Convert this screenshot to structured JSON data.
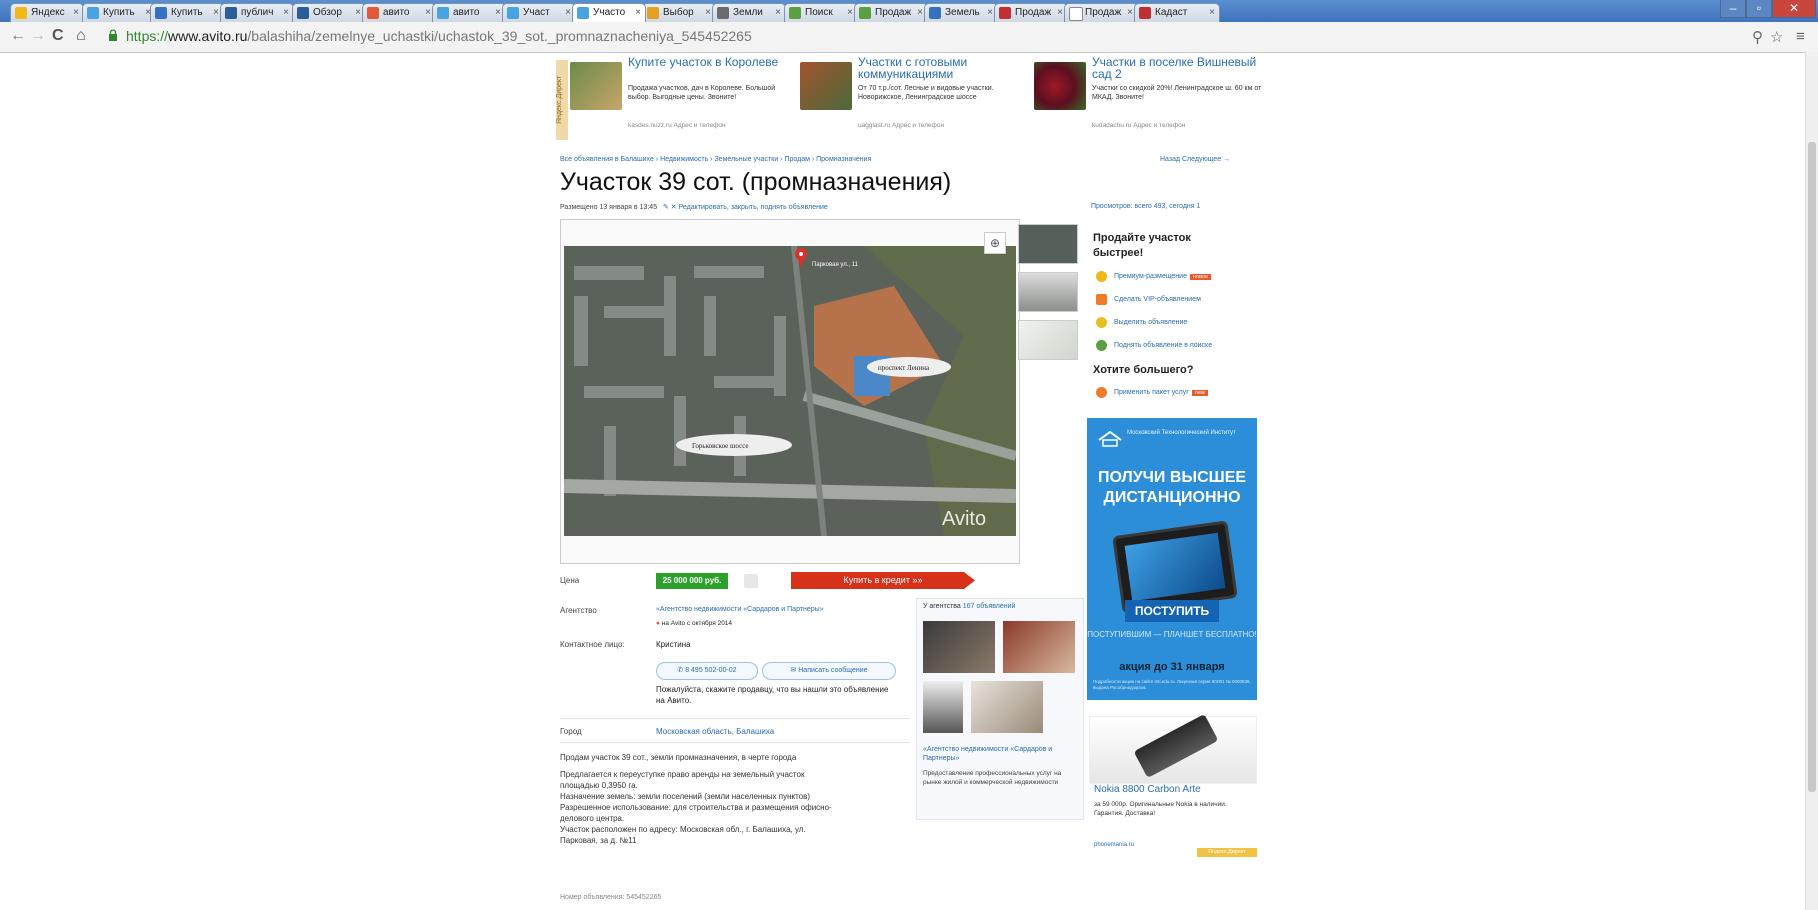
{
  "browser": {
    "tabs": [
      {
        "label": "Яндекс",
        "color": "#f2b81a"
      },
      {
        "label": "Купить",
        "color": "#47a4e0"
      },
      {
        "label": "Купить",
        "color": "#3670c0"
      },
      {
        "label": "публич",
        "color": "#2b5d99"
      },
      {
        "label": "Обзор",
        "color": "#2b5d99"
      },
      {
        "label": "авито",
        "color": "#e05a3a"
      },
      {
        "label": "авито",
        "color": "#47a4e0"
      },
      {
        "label": "Участ",
        "color": "#47a4e0"
      },
      {
        "label": "Участо",
        "color": "#47a4e0"
      },
      {
        "label": "Выбор",
        "color": "#e6a020"
      },
      {
        "label": "Земли",
        "color": "#6b6b6b"
      },
      {
        "label": "Поиск",
        "color": "#5aa040"
      },
      {
        "label": "Продаж",
        "color": "#5aa040"
      },
      {
        "label": "Земель",
        "color": "#3670c0"
      },
      {
        "label": "Продаж",
        "color": "#c03030"
      },
      {
        "label": "Продаж",
        "color": "#ffffff"
      },
      {
        "label": "Кадаст",
        "color": "#c03030"
      }
    ],
    "url_scheme": "https://",
    "url_host": "www.avito.ru",
    "url_path": "/balashiha/zemelnye_uchastki/uchastok_39_sot._promnaznacheniya_545452265"
  },
  "ads": [
    {
      "title": "Купите участок в Королеве",
      "desc": "Продажа участков, дач в Королеве. Большой выбор. Выгодные цены. Звоните!",
      "src": "kasdes.nuzz.ru   Адрес и телефон"
    },
    {
      "title": "Участки с готовыми коммуникациями",
      "desc": "От 70 т.р./сот. Лесные и видовые участки. Новорижское, Ленинградское шоссе",
      "src": "uagglast.ru   Адрес и телефон"
    },
    {
      "title": "Участки в поселке Вишневый сад 2",
      "desc": "Участки со скидкой 20%! Ленинградское ш. 60 км от МКАД. Звоните!",
      "src": "kudadachu.ru   Адрес и телефон"
    }
  ],
  "ad_label": "Яндекс.Директ",
  "breadcrumbs": "Все объявления в Балашихе  ›  Недвижимость  ›  Земельные участки  ›  Продам  ›  Промназначения",
  "nav_right": "Назад   Следующее →",
  "title": "Участок 39 сот. (промназначения)",
  "placed": "Размещено 13 января в 13:45",
  "placed_actions": "✎ ✕  Редактировать, закрыть, поднять объявление",
  "views": "Просмотров: всего 493, сегодня 1",
  "watermark": "Avito",
  "map_labels": {
    "street": "Парковая ул., 11",
    "prospekt": "проспект Ленина",
    "shosse": "Горьковское шоссе"
  },
  "price_label": "Цена",
  "price": "25 000 000 руб.",
  "credit_btn": "Купить в кредит »»",
  "agency_label": "Агентство",
  "agency_name": "«Агентство недвижимости «Сардаров и Партнеры»",
  "agency_since": "на Avito с октября 2014",
  "contact_label": "Контактное лицо:",
  "contact_name": "Кристина",
  "phone_btn": "8 495 502-00-02",
  "msg_btn": "Написать сообщение",
  "seller_note": "Пожалуйста, скажите продавцу, что вы нашли это объявление на Авито.",
  "city_label": "Город",
  "city": "Московская область, Балашиха",
  "desc_lines": [
    "Продам участок 39 сот., земли промназначения, в черте города",
    "",
    "Предлагается к переуступке право аренды на земельный участок",
    "площадью 0,3950 га.",
    "Назначение земель: земли поселений (земли населенных пунктов)",
    "Разрешенное использование: для строительства и размещения офисно-",
    "делового центра.",
    "Участок расположен по адресу: Московская обл., г. Балашиха, ул.",
    "Парковая, за д. №11"
  ],
  "agency_box": {
    "head": "У агентства",
    "count": "167 объявлений",
    "name": "«Агентство недвижимости «Сардаров и Партнеры»",
    "desc": "Предоставление профессиональных услуг на рынке жилой и коммерческой недвижимости"
  },
  "sell": {
    "heading": "Продайте участок быстрее!",
    "services": [
      {
        "label": "Премиум-размещение",
        "badge": "новое",
        "color": "#f2b81a"
      },
      {
        "label": "Сделать VIP-объявлением",
        "badge": "",
        "color": "#f07a2a"
      },
      {
        "label": "Выделить объявление",
        "badge": "",
        "color": "#e6c020"
      },
      {
        "label": "Поднять объявление в поиске",
        "badge": "",
        "color": "#5aa040"
      }
    ],
    "want": "Хотите большего?",
    "package": "Применить пакет услуг",
    "package_badge": "new"
  },
  "banner": {
    "org": "Московский Технологический Институт",
    "headline": "ПОЛУЧИ ВЫСШЕЕ ДИСТАНЦИОННО",
    "button": "ПОСТУПИТЬ",
    "sub": "ПОСТУПИВШИМ — ПЛАНШЕТ БЕСПЛАТНО!",
    "promo": "акция до 31 января",
    "fine": "Подробности акции на сайте mti.edu.ru. Лицензия серия 90Л01 № 0000836, выдана Рособрнадзором."
  },
  "nokia": {
    "title": "Nokia 8800 Carbon Arte",
    "desc": "за 59 000р. Оригинальные Nokia в наличии. Гарантия. Доставка!",
    "src": "phonemania.ru",
    "badge": "Яндекс.Директ"
  },
  "ad_number": "Номер объявления: 545452265"
}
